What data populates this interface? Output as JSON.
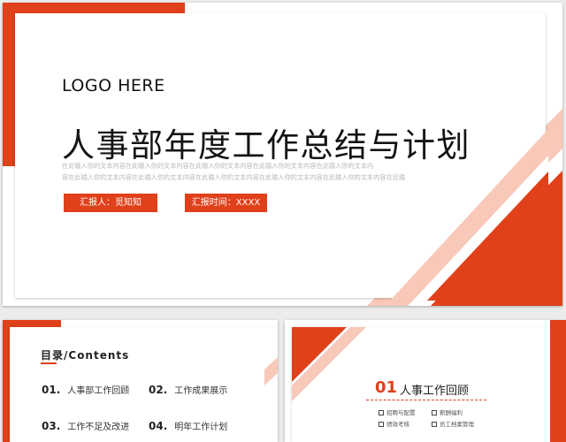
{
  "main": {
    "logo": "LOGO HERE",
    "title": "人事部年度工作总结与计划",
    "para_line1": "在此输入你的文本内容在此输入你的文本内容在此输入你的文本内容在此输入你的文本内容在此输入你的文本内",
    "para_line2": "容在此输入你的文本内容在此输入你的文本内容在此输入你的文本内容在此输入你的文本内容在此输入你的文本内容在此输",
    "reporter_tag": "汇报人：觅知知",
    "time_tag": "汇报时间：XXXX"
  },
  "toc": {
    "heading": "目录/Contents",
    "items": [
      {
        "num": "01.",
        "label": "人事部工作回顾"
      },
      {
        "num": "02.",
        "label": "工作成果展示"
      },
      {
        "num": "03.",
        "label": "工作不足及改进"
      },
      {
        "num": "04.",
        "label": "明年工作计划"
      }
    ]
  },
  "section": {
    "num": "01",
    "title": "人事工作回顾",
    "items": [
      "招聘与配置",
      "薪酬福利",
      "绩效考核",
      "员工档案管理"
    ]
  },
  "colors": {
    "accent": "#e0401a",
    "accent_light": "#f8c9b9"
  }
}
